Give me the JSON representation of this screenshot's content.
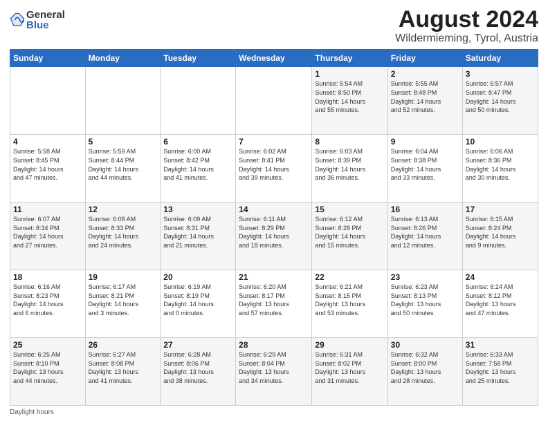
{
  "logo": {
    "general": "General",
    "blue": "Blue"
  },
  "title": {
    "month_year": "August 2024",
    "location": "Wildermieming, Tyrol, Austria"
  },
  "days_of_week": [
    "Sunday",
    "Monday",
    "Tuesday",
    "Wednesday",
    "Thursday",
    "Friday",
    "Saturday"
  ],
  "footer": {
    "daylight_label": "Daylight hours"
  },
  "weeks": [
    {
      "days": [
        {
          "num": "",
          "info": ""
        },
        {
          "num": "",
          "info": ""
        },
        {
          "num": "",
          "info": ""
        },
        {
          "num": "",
          "info": ""
        },
        {
          "num": "1",
          "info": "Sunrise: 5:54 AM\nSunset: 8:50 PM\nDaylight: 14 hours\nand 55 minutes."
        },
        {
          "num": "2",
          "info": "Sunrise: 5:55 AM\nSunset: 8:48 PM\nDaylight: 14 hours\nand 52 minutes."
        },
        {
          "num": "3",
          "info": "Sunrise: 5:57 AM\nSunset: 8:47 PM\nDaylight: 14 hours\nand 50 minutes."
        }
      ]
    },
    {
      "days": [
        {
          "num": "4",
          "info": "Sunrise: 5:58 AM\nSunset: 8:45 PM\nDaylight: 14 hours\nand 47 minutes."
        },
        {
          "num": "5",
          "info": "Sunrise: 5:59 AM\nSunset: 8:44 PM\nDaylight: 14 hours\nand 44 minutes."
        },
        {
          "num": "6",
          "info": "Sunrise: 6:00 AM\nSunset: 8:42 PM\nDaylight: 14 hours\nand 41 minutes."
        },
        {
          "num": "7",
          "info": "Sunrise: 6:02 AM\nSunset: 8:41 PM\nDaylight: 14 hours\nand 39 minutes."
        },
        {
          "num": "8",
          "info": "Sunrise: 6:03 AM\nSunset: 8:39 PM\nDaylight: 14 hours\nand 36 minutes."
        },
        {
          "num": "9",
          "info": "Sunrise: 6:04 AM\nSunset: 8:38 PM\nDaylight: 14 hours\nand 33 minutes."
        },
        {
          "num": "10",
          "info": "Sunrise: 6:06 AM\nSunset: 8:36 PM\nDaylight: 14 hours\nand 30 minutes."
        }
      ]
    },
    {
      "days": [
        {
          "num": "11",
          "info": "Sunrise: 6:07 AM\nSunset: 8:34 PM\nDaylight: 14 hours\nand 27 minutes."
        },
        {
          "num": "12",
          "info": "Sunrise: 6:08 AM\nSunset: 8:33 PM\nDaylight: 14 hours\nand 24 minutes."
        },
        {
          "num": "13",
          "info": "Sunrise: 6:09 AM\nSunset: 8:31 PM\nDaylight: 14 hours\nand 21 minutes."
        },
        {
          "num": "14",
          "info": "Sunrise: 6:11 AM\nSunset: 8:29 PM\nDaylight: 14 hours\nand 18 minutes."
        },
        {
          "num": "15",
          "info": "Sunrise: 6:12 AM\nSunset: 8:28 PM\nDaylight: 14 hours\nand 15 minutes."
        },
        {
          "num": "16",
          "info": "Sunrise: 6:13 AM\nSunset: 8:26 PM\nDaylight: 14 hours\nand 12 minutes."
        },
        {
          "num": "17",
          "info": "Sunrise: 6:15 AM\nSunset: 8:24 PM\nDaylight: 14 hours\nand 9 minutes."
        }
      ]
    },
    {
      "days": [
        {
          "num": "18",
          "info": "Sunrise: 6:16 AM\nSunset: 8:23 PM\nDaylight: 14 hours\nand 6 minutes."
        },
        {
          "num": "19",
          "info": "Sunrise: 6:17 AM\nSunset: 8:21 PM\nDaylight: 14 hours\nand 3 minutes."
        },
        {
          "num": "20",
          "info": "Sunrise: 6:19 AM\nSunset: 8:19 PM\nDaylight: 14 hours\nand 0 minutes."
        },
        {
          "num": "21",
          "info": "Sunrise: 6:20 AM\nSunset: 8:17 PM\nDaylight: 13 hours\nand 57 minutes."
        },
        {
          "num": "22",
          "info": "Sunrise: 6:21 AM\nSunset: 8:15 PM\nDaylight: 13 hours\nand 53 minutes."
        },
        {
          "num": "23",
          "info": "Sunrise: 6:23 AM\nSunset: 8:13 PM\nDaylight: 13 hours\nand 50 minutes."
        },
        {
          "num": "24",
          "info": "Sunrise: 6:24 AM\nSunset: 8:12 PM\nDaylight: 13 hours\nand 47 minutes."
        }
      ]
    },
    {
      "days": [
        {
          "num": "25",
          "info": "Sunrise: 6:25 AM\nSunset: 8:10 PM\nDaylight: 13 hours\nand 44 minutes."
        },
        {
          "num": "26",
          "info": "Sunrise: 6:27 AM\nSunset: 8:08 PM\nDaylight: 13 hours\nand 41 minutes."
        },
        {
          "num": "27",
          "info": "Sunrise: 6:28 AM\nSunset: 8:06 PM\nDaylight: 13 hours\nand 38 minutes."
        },
        {
          "num": "28",
          "info": "Sunrise: 6:29 AM\nSunset: 8:04 PM\nDaylight: 13 hours\nand 34 minutes."
        },
        {
          "num": "29",
          "info": "Sunrise: 6:31 AM\nSunset: 8:02 PM\nDaylight: 13 hours\nand 31 minutes."
        },
        {
          "num": "30",
          "info": "Sunrise: 6:32 AM\nSunset: 8:00 PM\nDaylight: 13 hours\nand 28 minutes."
        },
        {
          "num": "31",
          "info": "Sunrise: 6:33 AM\nSunset: 7:58 PM\nDaylight: 13 hours\nand 25 minutes."
        }
      ]
    }
  ]
}
